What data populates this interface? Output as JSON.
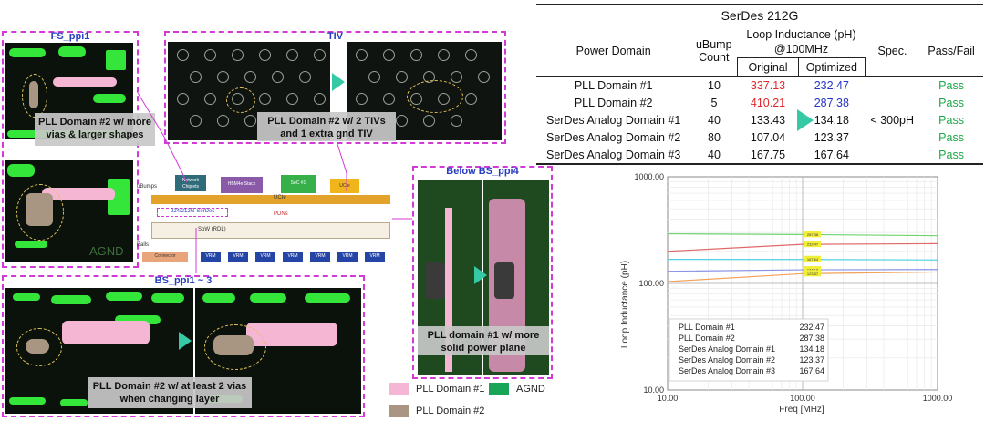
{
  "panels": {
    "fs_ppi1": {
      "title": "FS_ppi1",
      "caption": "PLL Domain #2 w/ more vias & larger shapes",
      "label_agnd": "AGND"
    },
    "tiv": {
      "title": "TIV",
      "caption": "PLL Domain #2 w/ 2 TIVs and 1 extra gnd TIV"
    },
    "bs_ppi1_3": {
      "title": "BS_ppi1 ~ 3",
      "caption": "PLL Domain #2 w/ at least 2 vias when changing layer"
    },
    "below_bs_ppi4": {
      "title": "Below BS_ppi4",
      "caption": "PLL domain #1 w/ more solid power plane"
    }
  },
  "package": {
    "ubumps": "uBumps",
    "chiplets": "Network Chiplets",
    "hbm": "HBM4e Stack",
    "soc": "SoC #1",
    "ucie_a": "UCIe",
    "ucie_b": "UCIe",
    "serdes": "224/212G-SerDes",
    "pdns": "PDNs",
    "sow": "SoW (RDL)",
    "balls": "Balls",
    "connector": "Connector",
    "vrm": [
      "VRM",
      "VRM",
      "VRM",
      "VRM",
      "VRM",
      "VRM",
      "VRM"
    ]
  },
  "legend": {
    "pll1": "PLL Domain #1",
    "pll2": "PLL Domain #2",
    "agnd": "AGND",
    "colors": {
      "pll1": "#f4b6d3",
      "pll2": "#a89683",
      "agnd": "#18a558"
    }
  },
  "table": {
    "title": "SerDes 212G",
    "headers": {
      "power_domain": "Power Domain",
      "ubump_count": "uBump Count",
      "loop_inductance": "Loop Inductance (pH) @100MHz",
      "original": "Original",
      "optimized": "Optimized",
      "spec": "Spec.",
      "pass_fail": "Pass/Fail"
    },
    "rows": [
      {
        "domain": "PLL Domain #1",
        "count": "10",
        "original": "337.13",
        "optimized": "232.47",
        "result": "Pass"
      },
      {
        "domain": "PLL Domain #2",
        "count": "5",
        "original": "410.21",
        "optimized": "287.38",
        "result": "Pass"
      },
      {
        "domain": "SerDes Analog Domain #1",
        "count": "40",
        "original": "133.43",
        "optimized": "134.18",
        "result": "Pass"
      },
      {
        "domain": "SerDes Analog Domain #2",
        "count": "80",
        "original": "107.04",
        "optimized": "123.37",
        "result": "Pass"
      },
      {
        "domain": "SerDes Analog Domain #3",
        "count": "40",
        "original": "167.75",
        "optimized": "167.64",
        "result": "Pass"
      }
    ],
    "spec_value": "< 300pH"
  },
  "chart_data": {
    "type": "line",
    "xlabel": "Freq [MHz]",
    "ylabel": "Loop Inductance (pH)",
    "x_scale": "log",
    "y_scale": "log",
    "xlim": [
      10,
      1000
    ],
    "ylim": [
      10,
      1000
    ],
    "x_ticks": [
      "10.00",
      "100.00",
      "1000.00"
    ],
    "y_ticks": [
      "1000.00",
      "100.00",
      "10.00"
    ],
    "grid": true,
    "legend_position": "bottom-left",
    "series": [
      {
        "name": "PLL Domain #1",
        "legend_value": "232.47",
        "color": "#e06a6a",
        "x": [
          10,
          100,
          1000
        ],
        "y": [
          200,
          232.47,
          236
        ]
      },
      {
        "name": "PLL Domain #2",
        "legend_value": "287.38",
        "color": "#6fd36f",
        "x": [
          10,
          100,
          1000
        ],
        "y": [
          292,
          287.38,
          280
        ]
      },
      {
        "name": "SerDes Analog Domain #1",
        "legend_value": "134.18",
        "color": "#8a93e6",
        "x": [
          10,
          100,
          1000
        ],
        "y": [
          130,
          134.18,
          135
        ]
      },
      {
        "name": "SerDes Analog Domain #2",
        "legend_value": "123.37",
        "color": "#f2a25a",
        "x": [
          10,
          100,
          1000
        ],
        "y": [
          104,
          123.37,
          128
        ]
      },
      {
        "name": "SerDes Analog Domain #3",
        "legend_value": "167.64",
        "color": "#4fd0e0",
        "x": [
          10,
          100,
          1000
        ],
        "y": [
          168,
          167.64,
          166
        ]
      }
    ]
  }
}
